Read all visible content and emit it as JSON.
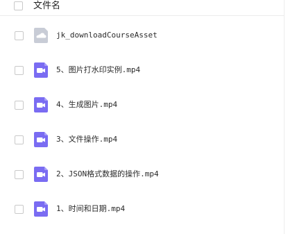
{
  "header": {
    "title": "文件名"
  },
  "colors": {
    "video_icon": "#7a6cf2",
    "folder_icon": "#c8ccd6"
  },
  "files": [
    {
      "name": "jk_downloadCourseAsset",
      "icon": "cloud-folder-icon"
    },
    {
      "name": "5、图片打水印实例.mp4",
      "icon": "video-icon"
    },
    {
      "name": "4、生成图片.mp4",
      "icon": "video-icon"
    },
    {
      "name": "3、文件操作.mp4",
      "icon": "video-icon"
    },
    {
      "name": "2、JSON格式数据的操作.mp4",
      "icon": "video-icon"
    },
    {
      "name": "1、时间和日期.mp4",
      "icon": "video-icon"
    }
  ]
}
